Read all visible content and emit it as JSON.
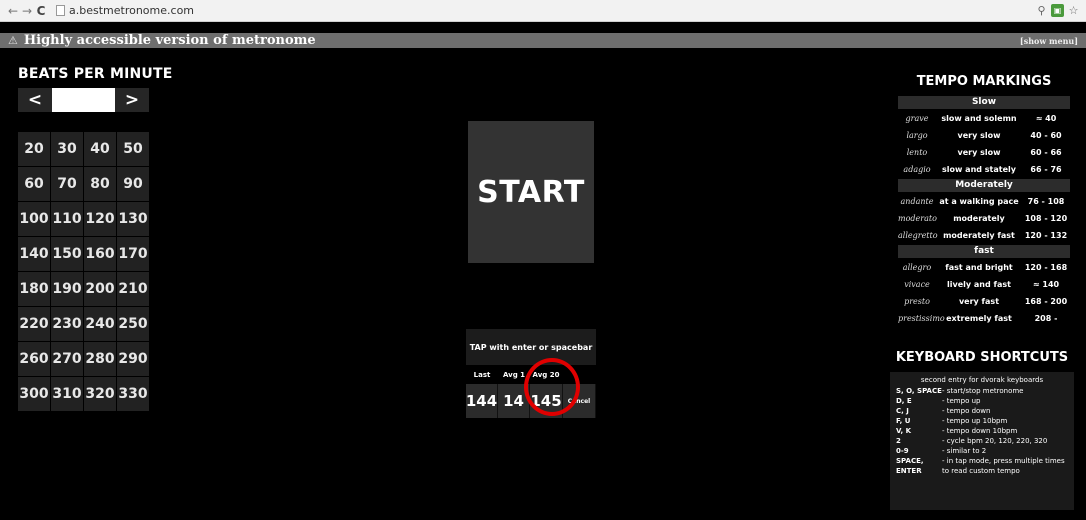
{
  "browser": {
    "url": "a.bestmetronome.com",
    "back_icon": "←",
    "forward_icon": "→",
    "reload_icon": "C"
  },
  "banner": {
    "warn_icon": "⚠",
    "title": "Highly accessible version of metronome",
    "show_menu": "[show menu]"
  },
  "bpm": {
    "title": "BEATS PER MINUTE",
    "dec_label": "<",
    "inc_label": ">",
    "field_value": "",
    "presets": [
      "20",
      "30",
      "40",
      "50",
      "60",
      "70",
      "80",
      "90",
      "100",
      "110",
      "120",
      "130",
      "140",
      "150",
      "160",
      "170",
      "180",
      "190",
      "200",
      "210",
      "220",
      "230",
      "240",
      "250",
      "260",
      "270",
      "280",
      "290",
      "300",
      "310",
      "320",
      "330"
    ]
  },
  "start": {
    "label": "START"
  },
  "tap": {
    "instruction": "TAP with enter or spacebar",
    "columns": [
      "Last",
      "Avg 1",
      "Avg 20",
      ""
    ],
    "values": [
      "144",
      "14",
      "145",
      "Cancel"
    ]
  },
  "tempo": {
    "title": "TEMPO MARKINGS",
    "groups": [
      {
        "name": "Slow",
        "rows": [
          {
            "it": "grave",
            "desc": "slow and solemn",
            "range": "≈ 40"
          },
          {
            "it": "largo",
            "desc": "very slow",
            "range": "40 - 60"
          },
          {
            "it": "lento",
            "desc": "very slow",
            "range": "60 - 66"
          },
          {
            "it": "adagio",
            "desc": "slow and stately",
            "range": "66 - 76"
          }
        ]
      },
      {
        "name": "Moderately",
        "rows": [
          {
            "it": "andante",
            "desc": "at a walking pace",
            "range": "76 - 108"
          },
          {
            "it": "moderato",
            "desc": "moderately",
            "range": "108 - 120"
          },
          {
            "it": "allegretto",
            "desc": "moderately fast",
            "range": "120 - 132"
          }
        ]
      },
      {
        "name": "fast",
        "rows": [
          {
            "it": "allegro",
            "desc": "fast and bright",
            "range": "120 - 168"
          },
          {
            "it": "vivace",
            "desc": "lively and fast",
            "range": "≈ 140"
          },
          {
            "it": "presto",
            "desc": "very fast",
            "range": "168 - 200"
          },
          {
            "it": "prestissimo",
            "desc": "extremely fast",
            "range": "208 -"
          }
        ]
      }
    ]
  },
  "shortcuts": {
    "title": "KEYBOARD SHORTCUTS",
    "note": "second entry for dvorak keyboards",
    "rows": [
      {
        "k": "S, O, SPACE",
        "d": "- start/stop metronome"
      },
      {
        "k": "D, E",
        "d": "- tempo up"
      },
      {
        "k": "C, J",
        "d": "- tempo down"
      },
      {
        "k": "F, U",
        "d": "- tempo up 10bpm"
      },
      {
        "k": "V, K",
        "d": "- tempo down 10bpm"
      },
      {
        "k": "2",
        "d": "- cycle bpm 20, 120, 220, 320"
      },
      {
        "k": "0-9",
        "d": "- similar to 2"
      },
      {
        "k": "SPACE, ENTER",
        "d": "- in tap mode, press multiple times to read custom tempo"
      }
    ]
  },
  "colors": {
    "highlight_circle": "#e00000",
    "banner": "#6e6e6e"
  }
}
